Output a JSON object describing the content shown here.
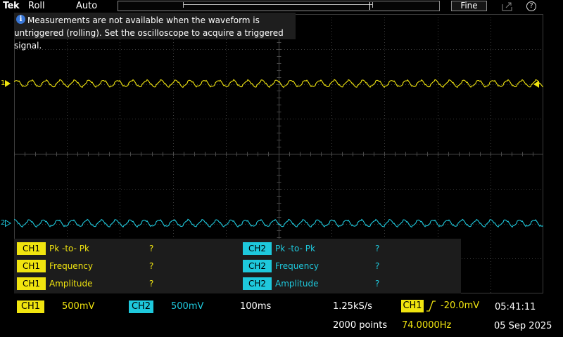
{
  "topbar": {
    "brand": "Tek",
    "mode": "Roll",
    "acquisition": "Auto",
    "fine_label": "Fine",
    "export_icon": "export-icon",
    "help_icon": "help-icon",
    "help_glyph": "?"
  },
  "banner": {
    "icon": "info-icon",
    "icon_glyph": "i",
    "text": "Measurements are not available when the waveform is untriggered (rolling). Set the oscilloscope to acquire a triggered signal."
  },
  "channels": {
    "ch1": {
      "number": "1",
      "color": "#f0e40f"
    },
    "ch2": {
      "number": "2",
      "color": "#1ec8dc"
    }
  },
  "measurements": {
    "ch1": [
      {
        "channel": "CH1",
        "name": "Pk -to- Pk",
        "value": "?"
      },
      {
        "channel": "CH1",
        "name": "Frequency",
        "value": "?"
      },
      {
        "channel": "CH1",
        "name": "Amplitude",
        "value": "?"
      }
    ],
    "ch2": [
      {
        "channel": "CH2",
        "name": "Pk -to- Pk",
        "value": "?"
      },
      {
        "channel": "CH2",
        "name": "Frequency",
        "value": "?"
      },
      {
        "channel": "CH2",
        "name": "Amplitude",
        "value": "?"
      }
    ]
  },
  "status": {
    "ch1_label": "CH1",
    "ch1_scale": "500mV",
    "ch2_label": "CH2",
    "ch2_scale": "500mV",
    "timebase": "100ms",
    "sample_rate": "1.25kS/s",
    "record_length": "2000 points",
    "trigger_source": "CH1",
    "trigger_level": "-20.0mV",
    "trigger_frequency": "74.0000Hz",
    "time": "05:41:11",
    "date": "05 Sep 2025"
  },
  "colors": {
    "background": "#000000",
    "grid": "#3c3c3c",
    "ch1": "#f0e40f",
    "ch2": "#1ec8dc",
    "panel": "#1c1c1c"
  }
}
